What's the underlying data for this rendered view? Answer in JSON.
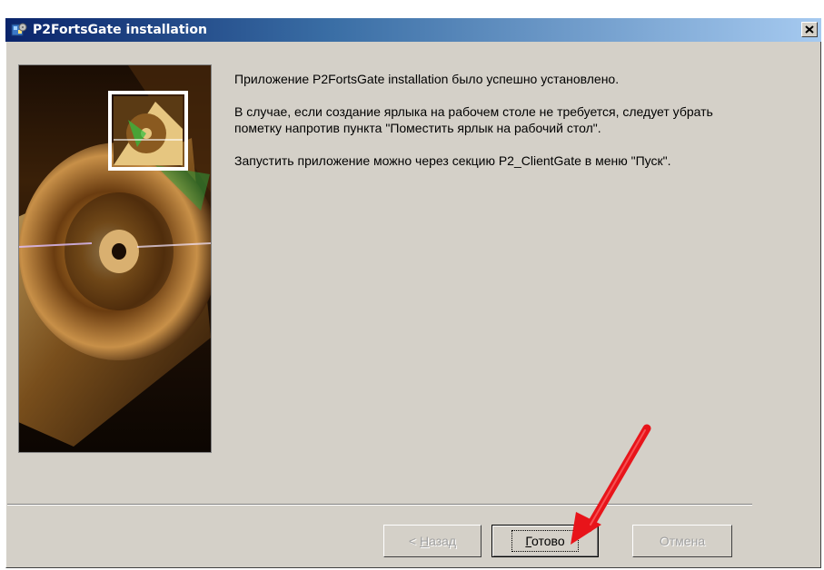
{
  "window": {
    "title": "P2FortsGate installation"
  },
  "message": {
    "paragraph1": "Приложение P2FortsGate installation было успешно установлено.",
    "paragraph2": "В случае, если создание ярлыка на рабочем столе не требуется, следует убрать пометку напротив пункта \"Поместить ярлык на рабочий стол\".",
    "paragraph3": "Запустить приложение можно через секцию P2_ClientGate в меню \"Пуск\"."
  },
  "buttons": {
    "back": {
      "prefix": "< ",
      "accel": "Н",
      "rest": "азад",
      "enabled": false
    },
    "finish": {
      "accel": "Г",
      "rest": "отово",
      "enabled": true
    },
    "cancel": {
      "label": "Отмена",
      "enabled": false
    }
  },
  "icons": {
    "app": "installer-icon",
    "close": "close-icon",
    "banner": "cd-disc-image",
    "annotation": "red-arrow-annotation"
  },
  "colors": {
    "titlebar_start": "#0a246a",
    "titlebar_end": "#a6caf0",
    "dialog_bg": "#d4d0c8",
    "arrow": "#e8141a"
  }
}
